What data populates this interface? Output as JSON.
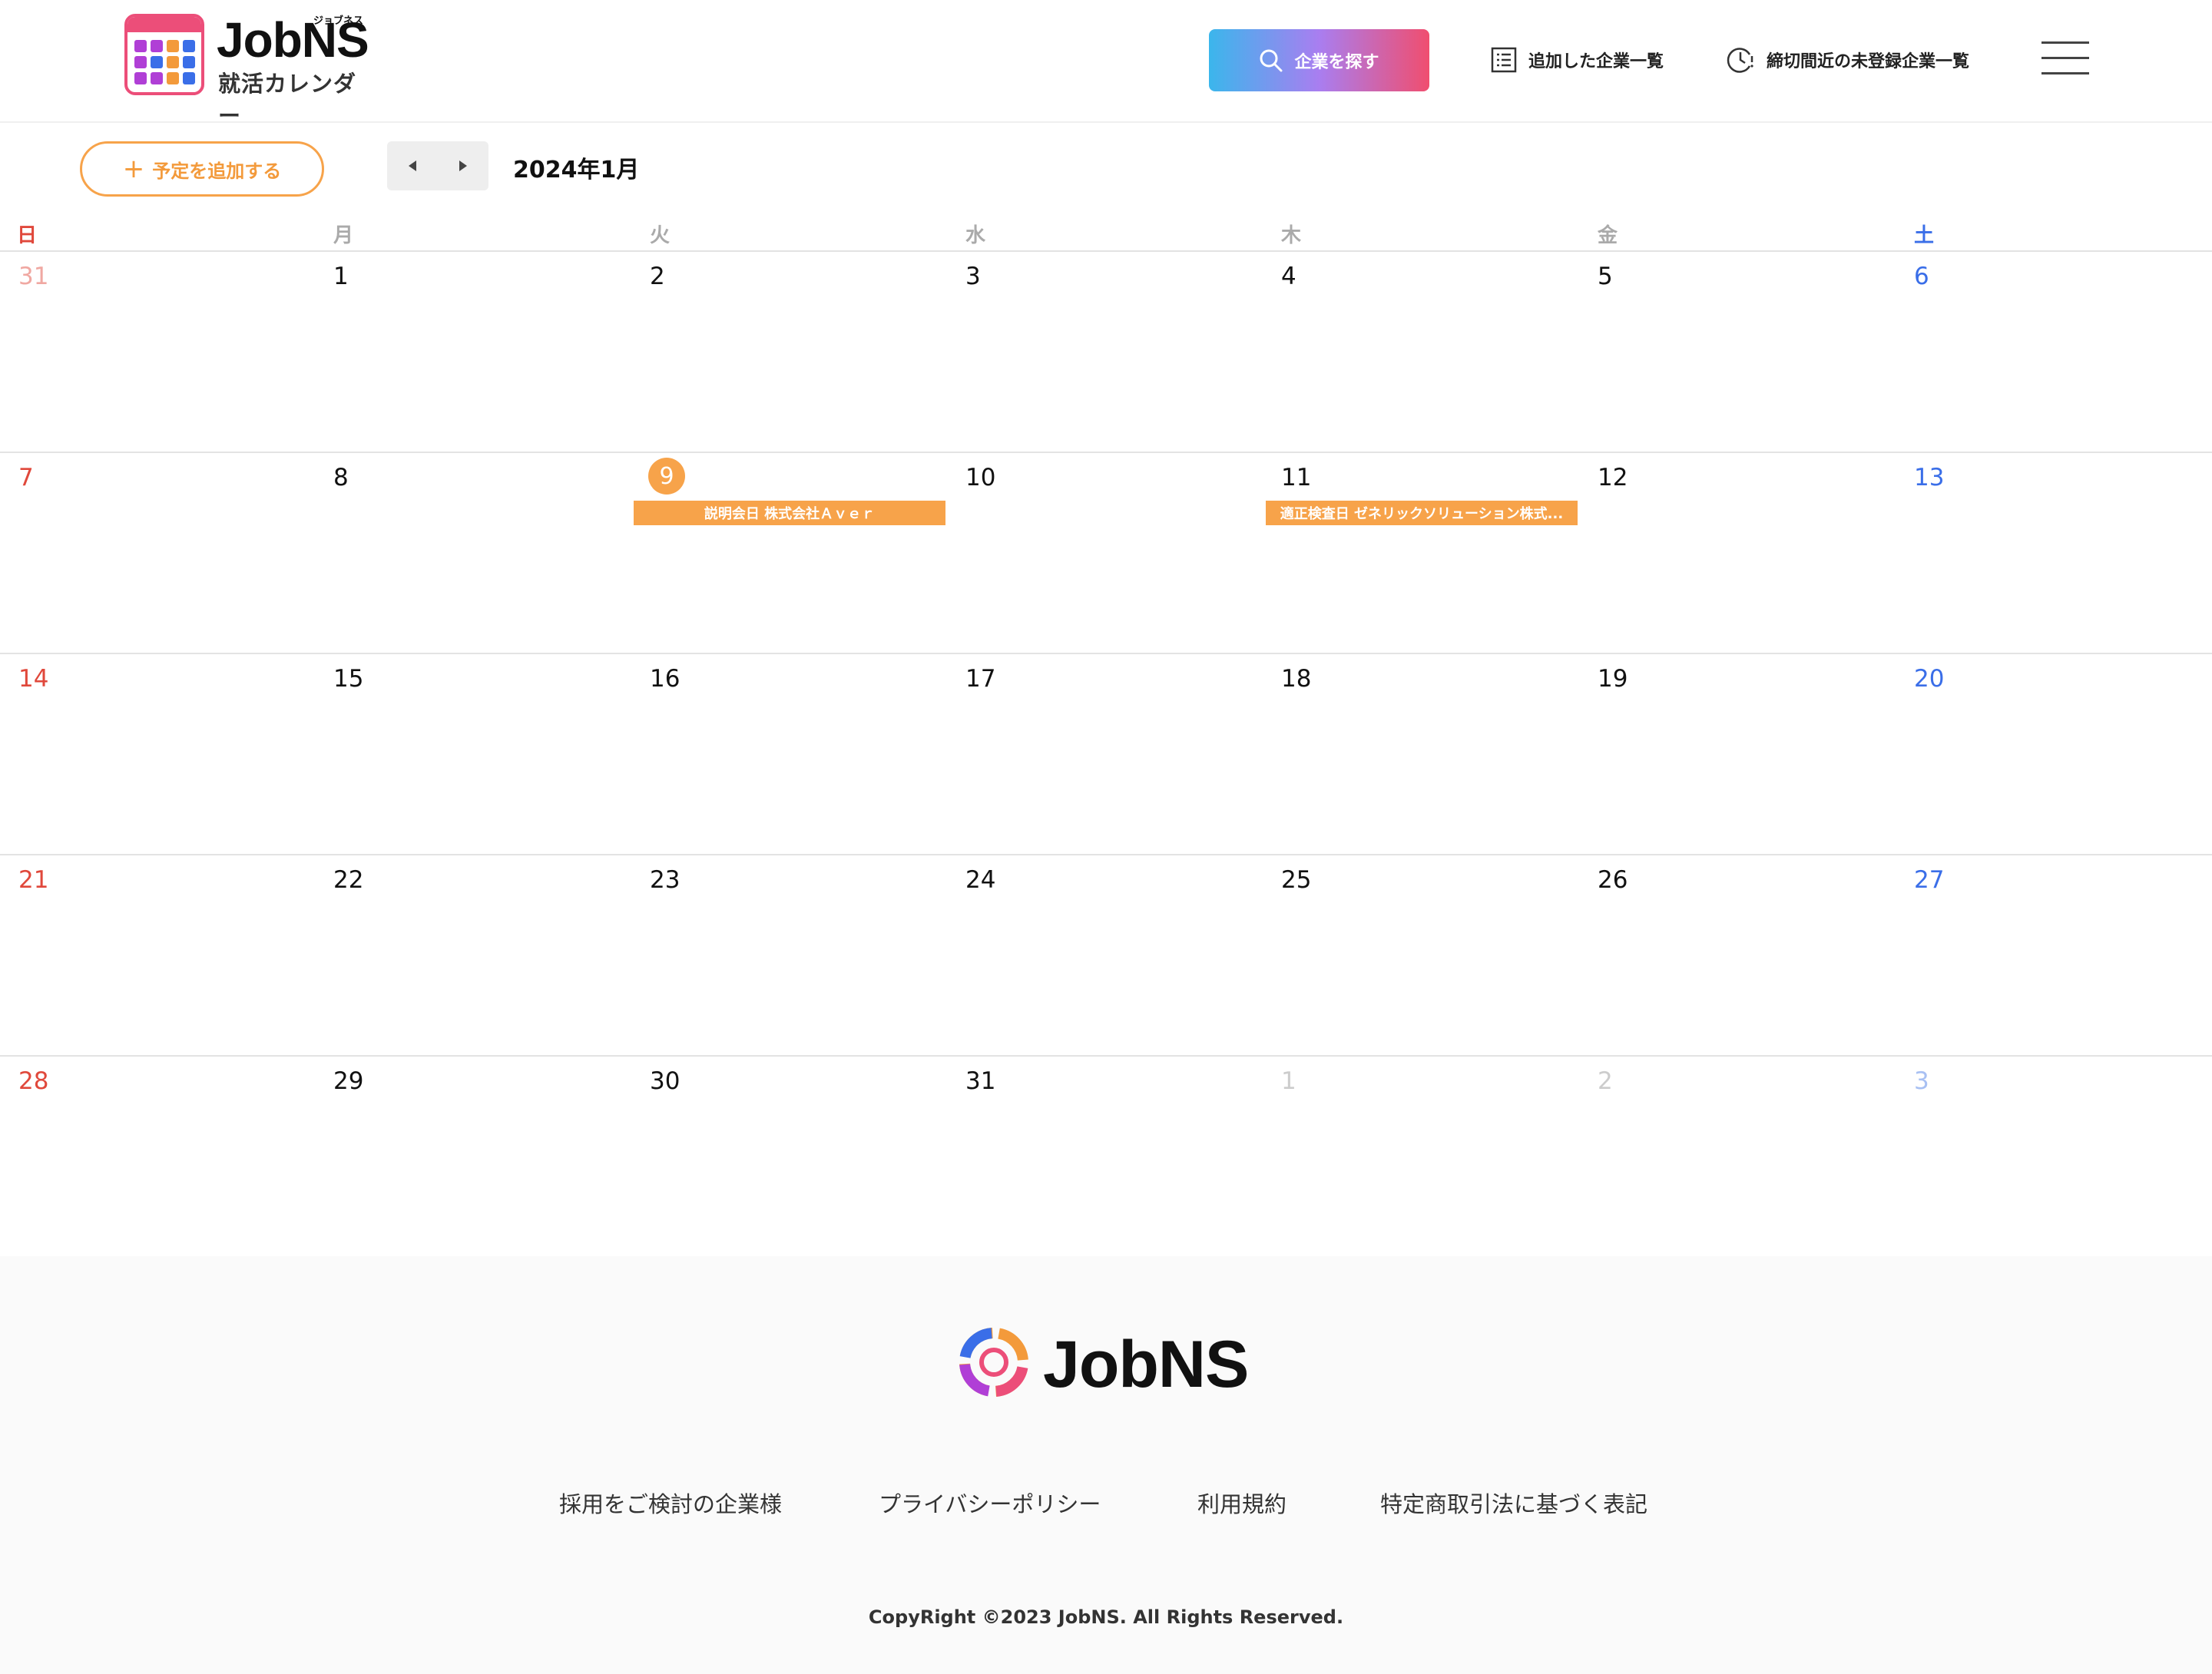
{
  "header": {
    "logo_title": "JobNS",
    "logo_ruby": "ジョブネス",
    "logo_subtitle": "就活カレンダー",
    "search_button": "企業を探す",
    "nav_added_companies": "追加した企業一覧",
    "nav_deadline_companies": "締切間近の未登録企業一覧"
  },
  "toolbar": {
    "add_event": "予定を追加する",
    "month_title": "2024年1月"
  },
  "weekdays": [
    "日",
    "月",
    "火",
    "水",
    "木",
    "金",
    "土"
  ],
  "weeks": [
    [
      "31",
      "1",
      "2",
      "3",
      "4",
      "5",
      "6"
    ],
    [
      "7",
      "8",
      "9",
      "10",
      "11",
      "12",
      "13"
    ],
    [
      "14",
      "15",
      "16",
      "17",
      "18",
      "19",
      "20"
    ],
    [
      "21",
      "22",
      "23",
      "24",
      "25",
      "26",
      "27"
    ],
    [
      "28",
      "29",
      "30",
      "31",
      "1",
      "2",
      "3"
    ]
  ],
  "today": "9",
  "events": [
    {
      "label": "説明会日 株式会社Ａｖｅｒ",
      "week": 1,
      "day": 2
    },
    {
      "label": "適正検査日 ゼネリックソリューション株式...",
      "week": 1,
      "day": 4
    }
  ],
  "colors": {
    "accent": "#f7a34a",
    "sunday": "#e0483b",
    "saturday": "#3a6ee8"
  },
  "footer": {
    "logo_text": "JobNS",
    "links": [
      "採用をご検討の企業様",
      "プライバシーポリシー",
      "利用規約",
      "特定商取引法に基づく表記"
    ],
    "copyright": "CopyRight ©2023 JobNS. All Rights Reserved."
  }
}
